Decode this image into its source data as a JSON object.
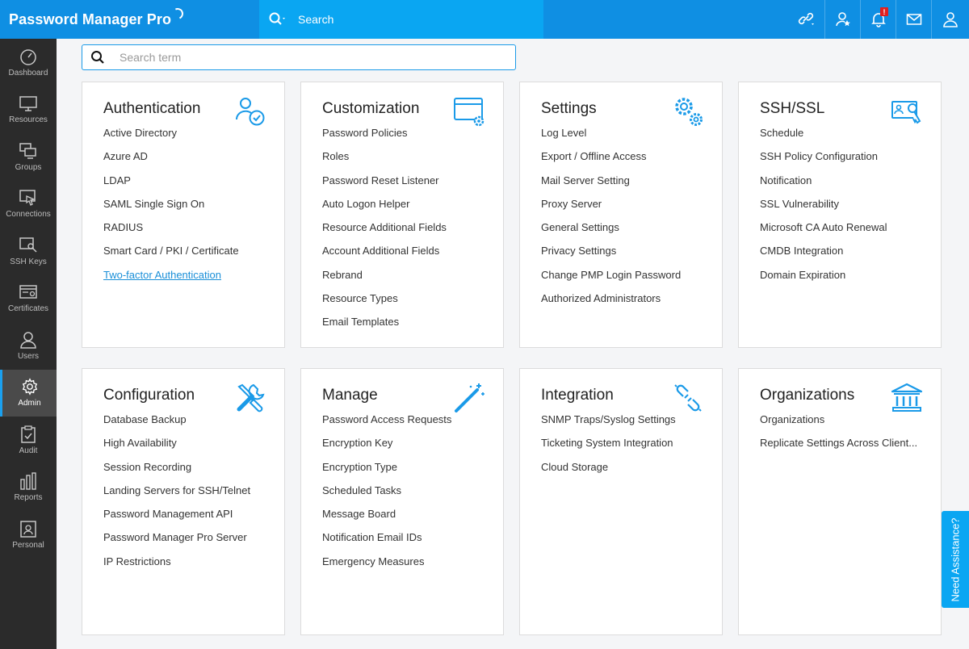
{
  "app": {
    "title": "Password Manager Pro",
    "top_search_label": "Search",
    "notification_badge": "!",
    "need_assistance": "Need Assistance?",
    "accent_color": "#0aa6f2"
  },
  "search": {
    "placeholder": "Search term",
    "value": ""
  },
  "sidebar": {
    "items": [
      {
        "label": "Dashboard",
        "icon": "dashboard-icon"
      },
      {
        "label": "Resources",
        "icon": "monitor-icon"
      },
      {
        "label": "Groups",
        "icon": "groups-icon"
      },
      {
        "label": "Connections",
        "icon": "connections-icon"
      },
      {
        "label": "SSH Keys",
        "icon": "key-icon"
      },
      {
        "label": "Certificates",
        "icon": "certificate-icon"
      },
      {
        "label": "Users",
        "icon": "user-icon"
      },
      {
        "label": "Admin",
        "icon": "gear-icon",
        "active": true
      },
      {
        "label": "Audit",
        "icon": "clipboard-icon"
      },
      {
        "label": "Reports",
        "icon": "bar-chart-icon"
      },
      {
        "label": "Personal",
        "icon": "contact-card-icon"
      }
    ]
  },
  "cards": [
    {
      "title": "Authentication",
      "icon": "user-check-icon",
      "items": [
        "Active Directory",
        "Azure AD",
        "LDAP",
        "SAML Single Sign On",
        "RADIUS",
        "Smart Card / PKI / Certificate",
        "Two-factor Authentication"
      ]
    },
    {
      "title": "Customization",
      "icon": "window-gear-icon",
      "items": [
        "Password Policies",
        "Roles",
        "Password Reset Listener",
        "Auto Logon Helper",
        "Resource Additional Fields",
        "Account Additional Fields",
        "Rebrand",
        "Resource Types",
        "Email Templates"
      ]
    },
    {
      "title": "Settings",
      "icon": "gears-icon",
      "items": [
        "Log Level",
        "Export / Offline Access",
        "Mail Server Setting",
        "Proxy Server",
        "General Settings",
        "Privacy Settings",
        "Change PMP Login Password",
        "Authorized Administrators"
      ]
    },
    {
      "title": "SSH/SSL",
      "icon": "id-key-icon",
      "items": [
        "Schedule",
        "SSH Policy Configuration",
        "Notification",
        "SSL Vulnerability",
        "Microsoft CA Auto Renewal",
        "CMDB Integration",
        "Domain Expiration"
      ]
    },
    {
      "title": "Configuration",
      "icon": "tools-icon",
      "items": [
        "Database Backup",
        "High Availability",
        "Session Recording",
        "Landing Servers for SSH/Telnet",
        "Password Management API",
        "Password Manager Pro Server",
        "IP Restrictions"
      ]
    },
    {
      "title": "Manage",
      "icon": "magic-wand-icon",
      "items": [
        "Password Access Requests",
        "Encryption Key",
        "Encryption Type",
        "Scheduled Tasks",
        "Message Board",
        "Notification Email IDs",
        "Emergency Measures"
      ]
    },
    {
      "title": "Integration",
      "icon": "chain-link-icon",
      "items": [
        "SNMP Traps/Syslog Settings",
        "Ticketing System Integration",
        "Cloud Storage"
      ]
    },
    {
      "title": "Organizations",
      "icon": "bank-icon",
      "items": [
        "Organizations",
        "Replicate Settings Across Client..."
      ]
    }
  ]
}
